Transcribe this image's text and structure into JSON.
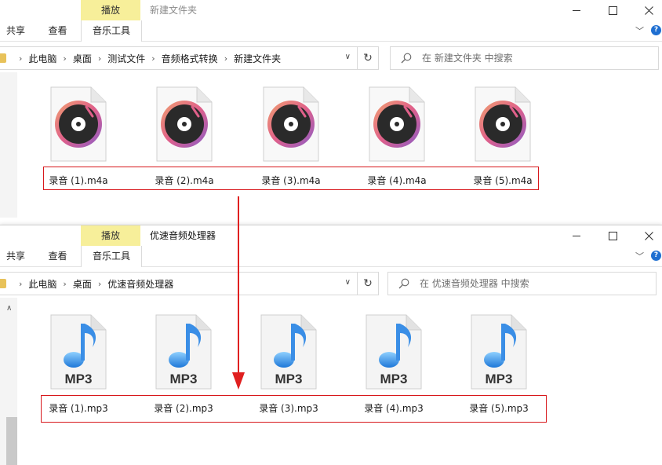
{
  "colors": {
    "accent_box": "#d8181c",
    "contextual_tab": "#f7ef9a",
    "help_icon": "#1f6fd1",
    "arrow": "#e02020"
  },
  "window1": {
    "contextual_header": "播放",
    "title": "新建文件夹",
    "ribbon": {
      "share": "共享",
      "view": "查看",
      "music_tools": "音乐工具"
    },
    "breadcrumbs": [
      "此电脑",
      "桌面",
      "测试文件",
      "音频格式转换",
      "新建文件夹"
    ],
    "search_placeholder": "在 新建文件夹 中搜索",
    "files": [
      {
        "name": "录音 (1).m4a",
        "icon": "m4a-record-icon"
      },
      {
        "name": "录音 (2).m4a",
        "icon": "m4a-record-icon"
      },
      {
        "name": "录音 (3).m4a",
        "icon": "m4a-record-icon"
      },
      {
        "name": "录音 (4).m4a",
        "icon": "m4a-record-icon"
      },
      {
        "name": "录音 (5).m4a",
        "icon": "m4a-record-icon"
      }
    ]
  },
  "window2": {
    "contextual_header": "播放",
    "title": "优速音频处理器",
    "ribbon": {
      "share": "共享",
      "view": "查看",
      "music_tools": "音乐工具"
    },
    "breadcrumbs": [
      "此电脑",
      "桌面",
      "优速音频处理器"
    ],
    "search_placeholder": "在 优速音频处理器 中搜索",
    "files": [
      {
        "name": "录音 (1).mp3",
        "icon": "mp3-note-icon",
        "badge": "MP3"
      },
      {
        "name": "录音 (2).mp3",
        "icon": "mp3-note-icon",
        "badge": "MP3"
      },
      {
        "name": "录音 (3).mp3",
        "icon": "mp3-note-icon",
        "badge": "MP3"
      },
      {
        "name": "录音 (4).mp3",
        "icon": "mp3-note-icon",
        "badge": "MP3"
      },
      {
        "name": "录音 (5).mp3",
        "icon": "mp3-note-icon",
        "badge": "MP3"
      }
    ]
  }
}
